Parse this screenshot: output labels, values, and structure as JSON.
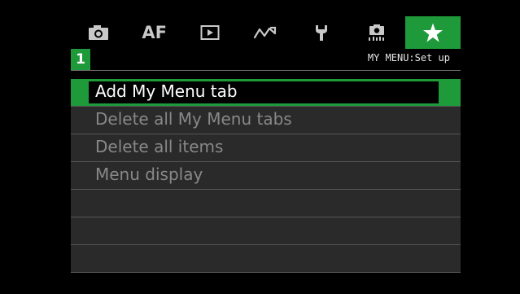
{
  "tabs": [
    {
      "name": "camera-icon",
      "active": false
    },
    {
      "name": "af",
      "label": "AF",
      "active": false
    },
    {
      "name": "playback-icon",
      "active": false
    },
    {
      "name": "wireless-icon",
      "active": false
    },
    {
      "name": "wrench-icon",
      "active": false
    },
    {
      "name": "custom-functions-icon",
      "active": false
    },
    {
      "name": "star-icon",
      "active": true
    }
  ],
  "subheader": {
    "tab_number": "1",
    "title": "MY MENU:Set up"
  },
  "menu": {
    "items": [
      {
        "label": "Add My Menu tab",
        "selected": true
      },
      {
        "label": "Delete all My Menu tabs",
        "selected": false
      },
      {
        "label": "Delete all items",
        "selected": false
      },
      {
        "label": "Menu display",
        "selected": false
      },
      {
        "label": "",
        "selected": false
      },
      {
        "label": "",
        "selected": false
      },
      {
        "label": "",
        "selected": false
      }
    ]
  },
  "colors": {
    "accent": "#1e9a3a",
    "row_bg": "#2a2a2a",
    "dim_text": "#888888"
  }
}
